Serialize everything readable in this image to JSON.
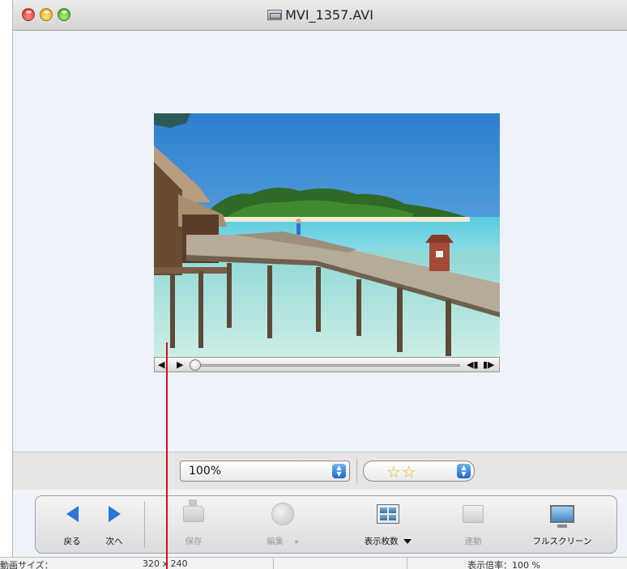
{
  "window": {
    "title": "MVI_1357.AVI"
  },
  "player": {
    "speaker_glyph": "◀)",
    "play_glyph": "▶",
    "step_back_glyph": "◀▮",
    "step_forward_glyph": "▮▶",
    "progress": 0
  },
  "options": {
    "zoom_value": "100%",
    "rating_value": "☆☆"
  },
  "toolbar": {
    "back_label": "戻る",
    "next_label": "次へ",
    "save_label": "保存",
    "edit_label": "編集",
    "count_label": "表示枚数",
    "continuous_label": "連動",
    "fullscreen_label": "フルスクリーン",
    "menu_chevron": "»"
  },
  "status": {
    "size_label": "動画サイズ：",
    "size_value": "320 x 240",
    "zoom_label": "表示倍率：100 %"
  },
  "colors": {
    "accent": "#2b77d4",
    "pointer_line": "#d0121b",
    "star": "#e2b90a"
  }
}
